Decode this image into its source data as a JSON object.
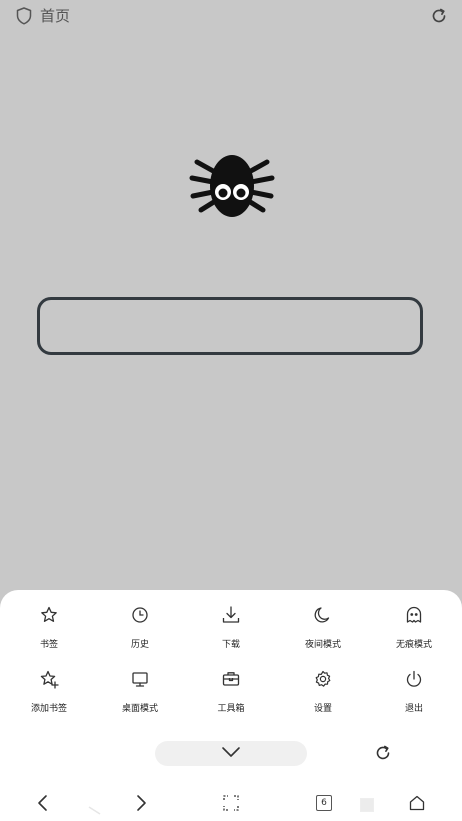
{
  "header": {
    "title": "首页",
    "icons": [
      "shield-icon",
      "refresh-icon"
    ]
  },
  "menu": {
    "row1": [
      {
        "label": "书签",
        "icon": "star-icon"
      },
      {
        "label": "历史",
        "icon": "clock-icon"
      },
      {
        "label": "下载",
        "icon": "download-icon"
      },
      {
        "label": "夜间模式",
        "icon": "moon-icon"
      },
      {
        "label": "无痕模式",
        "icon": "ghost-icon"
      }
    ],
    "row2": [
      {
        "label": "添加书签",
        "icon": "star-plus-icon"
      },
      {
        "label": "桌面模式",
        "icon": "monitor-icon"
      },
      {
        "label": "工具箱",
        "icon": "toolbox-icon"
      },
      {
        "label": "设置",
        "icon": "gear-icon"
      },
      {
        "label": "退出",
        "icon": "power-icon"
      }
    ]
  },
  "bottom_nav": {
    "tab_count": "6"
  },
  "colors": {
    "background": "#c8c8c8",
    "sheet": "#ffffff",
    "accent": "#333a40"
  }
}
